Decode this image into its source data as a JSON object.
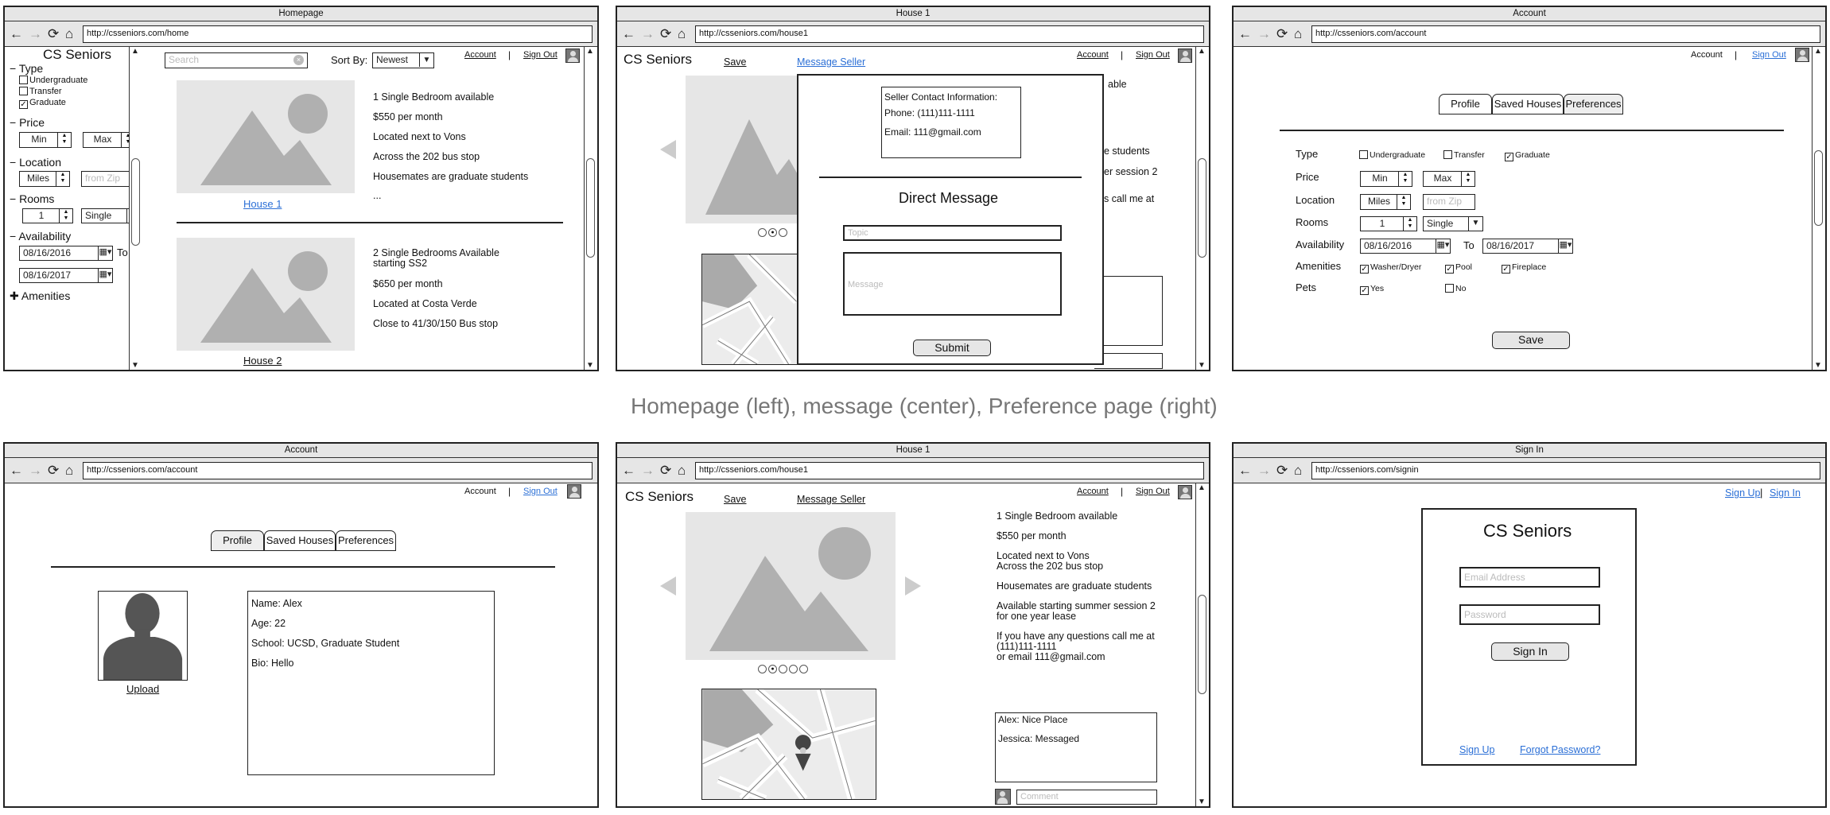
{
  "caption": "Homepage (left), message (center), Preference page (right)",
  "nav_icons": {
    "back": "←",
    "forward": "→",
    "refresh": "⟳",
    "home": "⌂"
  },
  "common": {
    "account": "Account",
    "sign_out": "Sign Out",
    "sep": "|",
    "brand": "CS Seniors"
  },
  "home": {
    "title": "Homepage",
    "url": "http://csseniors.com/home",
    "search_placeholder": "Search",
    "sort_label": "Sort By:",
    "sort_value": "Newest",
    "filters": {
      "type_label": "Type",
      "type_options": [
        "Undergraduate",
        "Transfer",
        "Graduate"
      ],
      "price_label": "Price",
      "min": "Min",
      "max": "Max",
      "location_label": "Location",
      "miles": "Miles",
      "zip_placeholder": "from Zip",
      "rooms_label": "Rooms",
      "rooms_value": "1",
      "rooms_type": "Single",
      "availability_label": "Availability",
      "date_from": "08/16/2016",
      "to": "To",
      "date_to": "08/16/2017",
      "amenities_label": "Amenities"
    },
    "listing1": {
      "link": "House 1",
      "lines": [
        "1 Single Bedroom available",
        "$550 per month",
        "Located next to Vons",
        "Across the 202 bus stop",
        "Housemates are graduate students",
        "..."
      ]
    },
    "listing2": {
      "link": "House 2",
      "lines": [
        "2 Single Bedrooms Available",
        "starting SS2",
        "$650 per month",
        "Located at Costa Verde",
        "Close to 41/30/150 Bus stop"
      ]
    }
  },
  "msg": {
    "title": "House 1",
    "url": "http://csseniors.com/house1",
    "save": "Save",
    "message_seller": "Message Seller",
    "seller_title": "Seller Contact Information:",
    "phone": "Phone: (111)111-1111",
    "email": "Email: 111@gmail.com",
    "dm_title": "Direct Message",
    "topic_placeholder": "Topic",
    "message_placeholder": "Message",
    "submit": "Submit",
    "bg_frags": [
      "able",
      "e students",
      "er session 2",
      "s call me at"
    ]
  },
  "pref": {
    "title": "Account",
    "url": "http://csseniors.com/account",
    "tabs": [
      "Profile",
      "Saved Houses",
      "Preferences"
    ],
    "type_label": "Type",
    "type_options": [
      "Undergraduate",
      "Transfer",
      "Graduate"
    ],
    "price_label": "Price",
    "min": "Min",
    "max": "Max",
    "location_label": "Location",
    "miles": "Miles",
    "zip_placeholder": "from Zip",
    "rooms_label": "Rooms",
    "rooms_value": "1",
    "rooms_type": "Single",
    "availability_label": "Availability",
    "date_from": "08/16/2016",
    "to": "To",
    "date_to": "08/16/2017",
    "amenities_label": "Amenities",
    "amenities": [
      "Washer/Dryer",
      "Pool",
      "Fireplace"
    ],
    "pets_label": "Pets",
    "pets": [
      "Yes",
      "No"
    ],
    "save": "Save"
  },
  "profile": {
    "title": "Account",
    "url": "http://csseniors.com/account",
    "tabs": [
      "Profile",
      "Saved Houses",
      "Preferences"
    ],
    "upload": "Upload",
    "fields": [
      "Name: Alex",
      "Age: 22",
      "School: UCSD, Graduate Student",
      "Bio: Hello"
    ]
  },
  "house": {
    "title": "House 1",
    "url": "http://csseniors.com/house1",
    "save": "Save",
    "message_seller": "Message Seller",
    "details": [
      "1 Single Bedroom available",
      "$550 per month",
      "Located next to Vons",
      "Across the 202 bus stop",
      "Housemates are graduate students",
      "Available starting summer session 2",
      "for one year lease",
      "If you have any questions call me at",
      "(111)111-1111",
      "or email 111@gmail.com"
    ],
    "comments": [
      "Alex: Nice Place",
      "Jessica: Messaged"
    ],
    "comment_placeholder": "Comment"
  },
  "signin": {
    "title": "Sign In",
    "url": "http://csseniors.com/signin",
    "sign_up": "Sign Up",
    "sign_in": "Sign In",
    "email_placeholder": "Email Address",
    "password_placeholder": "Password",
    "button": "Sign In",
    "forgot": "Forgot Password?"
  }
}
